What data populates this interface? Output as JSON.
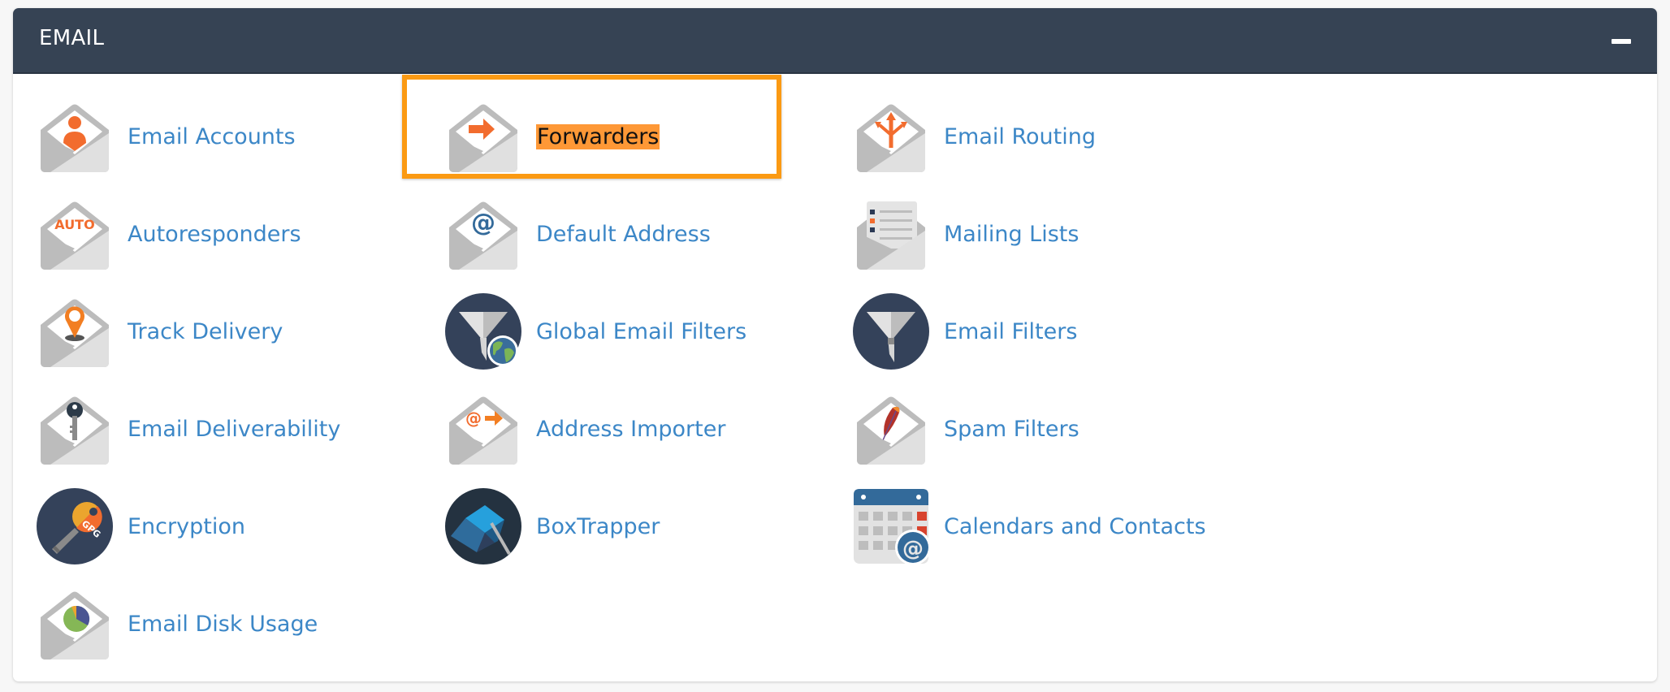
{
  "section": {
    "title": "EMAIL",
    "collapse_button": "collapse-icon"
  },
  "highlighted_item": "Forwarders",
  "colors": {
    "header_bg": "#364354",
    "link": "#3c87c7",
    "highlight_border": "#fb9a13",
    "highlight_text_bg": "#fe9836",
    "accent_orange": "#f26c2e",
    "icon_dark_circle": "#34425a"
  },
  "items": [
    {
      "label": "Email Accounts",
      "icon": "email-accounts-icon"
    },
    {
      "label": "Forwarders",
      "icon": "forwarders-icon"
    },
    {
      "label": "Email Routing",
      "icon": "email-routing-icon"
    },
    {
      "label": "Autoresponders",
      "icon": "autoresponders-icon",
      "icon_text": "AUTO"
    },
    {
      "label": "Default Address",
      "icon": "default-address-icon"
    },
    {
      "label": "Mailing Lists",
      "icon": "mailing-lists-icon"
    },
    {
      "label": "Track Delivery",
      "icon": "track-delivery-icon"
    },
    {
      "label": "Global Email Filters",
      "icon": "global-email-filters-icon"
    },
    {
      "label": "Email Filters",
      "icon": "email-filters-icon"
    },
    {
      "label": "Email Deliverability",
      "icon": "email-deliverability-icon"
    },
    {
      "label": "Address Importer",
      "icon": "address-importer-icon"
    },
    {
      "label": "Spam Filters",
      "icon": "spam-filters-icon"
    },
    {
      "label": "Encryption",
      "icon": "encryption-icon",
      "icon_text": "GPG"
    },
    {
      "label": "BoxTrapper",
      "icon": "boxtrapper-icon"
    },
    {
      "label": "Calendars and Contacts",
      "icon": "calendars-and-contacts-icon"
    },
    {
      "label": "Email Disk Usage",
      "icon": "email-disk-usage-icon"
    }
  ]
}
